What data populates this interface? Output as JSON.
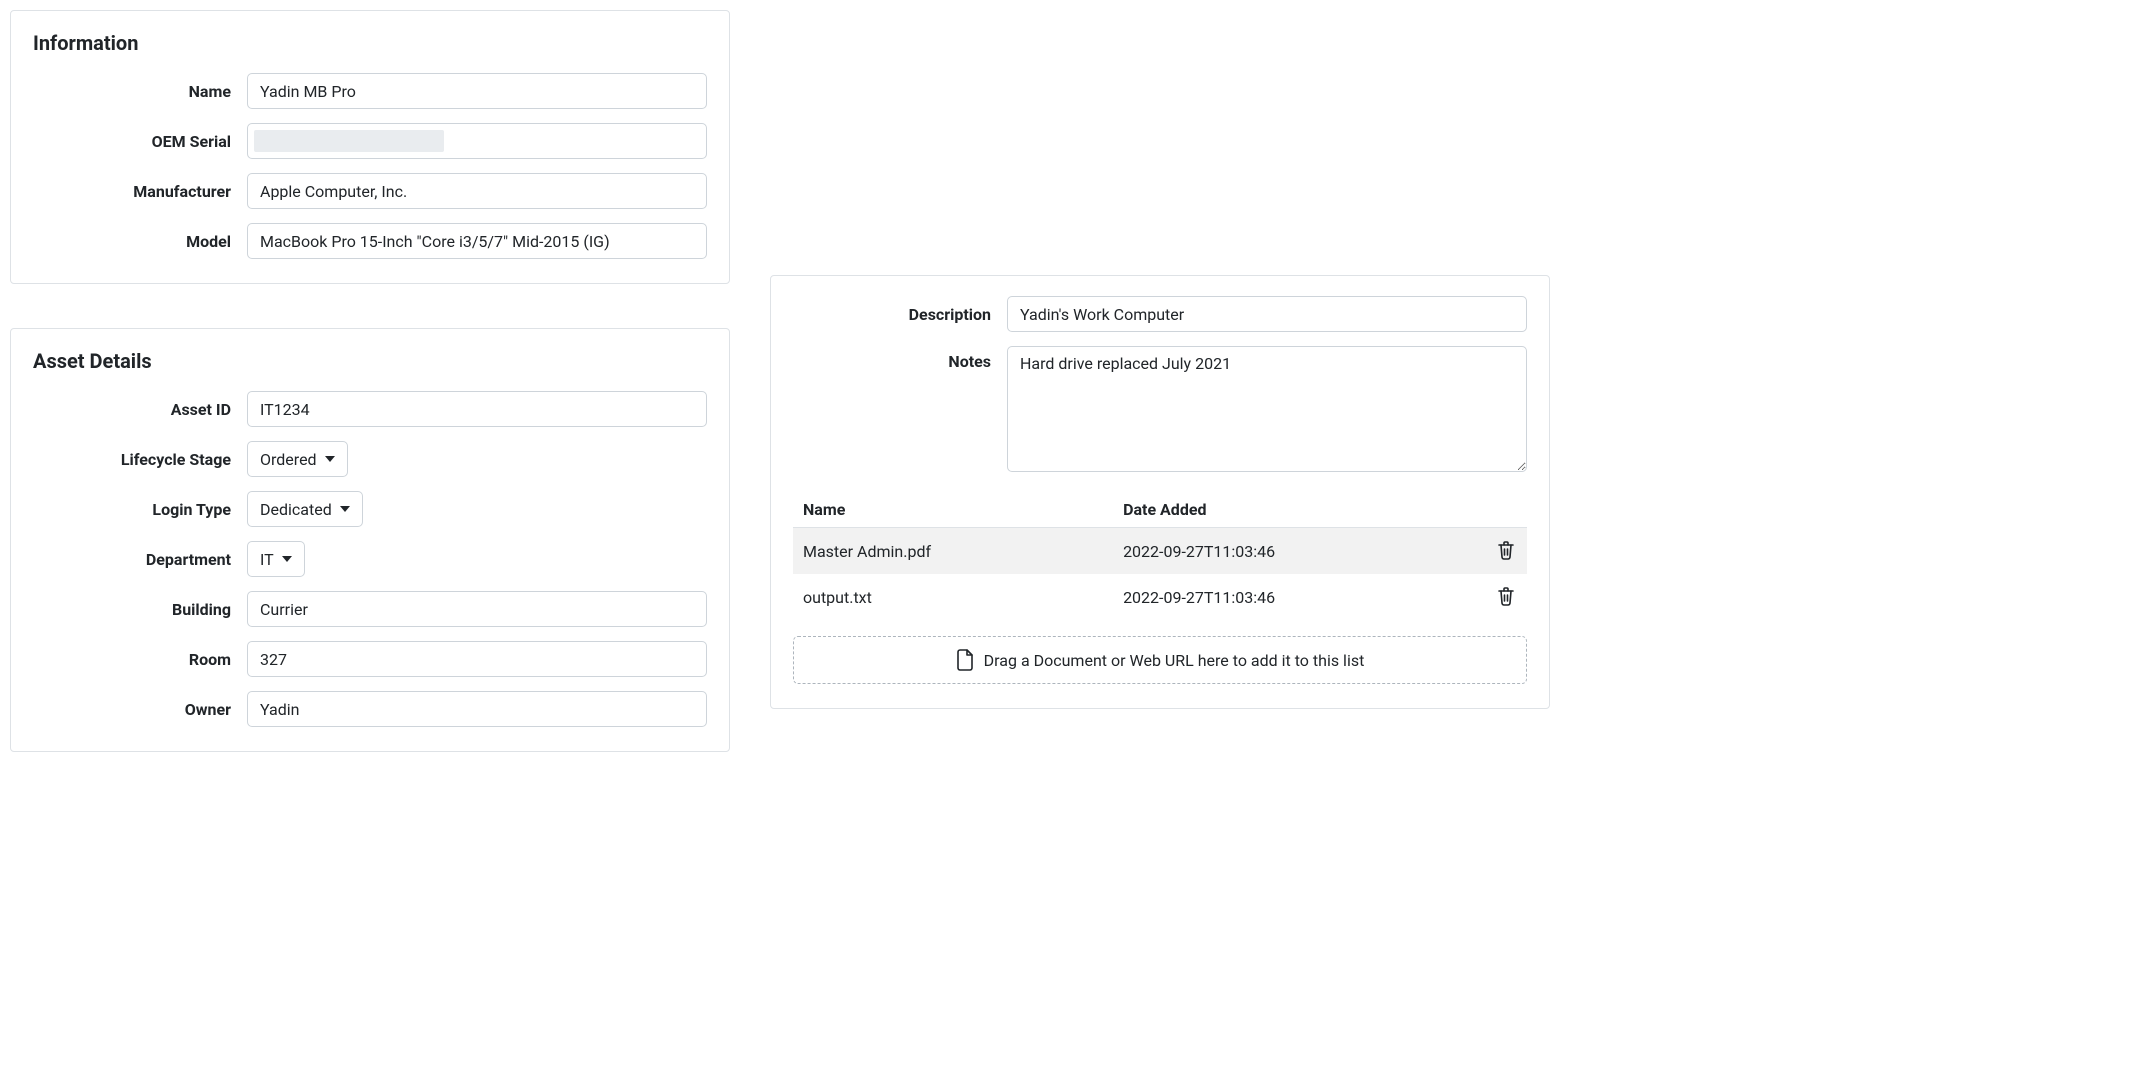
{
  "information": {
    "title": "Information",
    "labels": {
      "name": "Name",
      "oem_serial": "OEM Serial",
      "manufacturer": "Manufacturer",
      "model": "Model"
    },
    "values": {
      "name": "Yadin MB Pro",
      "oem_serial": "",
      "manufacturer": "Apple Computer, Inc.",
      "model": "MacBook Pro 15-Inch \"Core i3/5/7\" Mid-2015 (IG)"
    }
  },
  "asset_details": {
    "title": "Asset Details",
    "labels": {
      "asset_id": "Asset ID",
      "lifecycle_stage": "Lifecycle Stage",
      "login_type": "Login Type",
      "department": "Department",
      "building": "Building",
      "room": "Room",
      "owner": "Owner"
    },
    "values": {
      "asset_id": "IT1234",
      "lifecycle_stage": "Ordered",
      "login_type": "Dedicated",
      "department": "IT",
      "building": "Currier",
      "room": "327",
      "owner": "Yadin"
    }
  },
  "desc": {
    "labels": {
      "description": "Description",
      "notes": "Notes"
    },
    "values": {
      "description": "Yadin's Work Computer",
      "notes": "Hard drive replaced July 2021"
    }
  },
  "documents": {
    "columns": {
      "name": "Name",
      "date_added": "Date Added"
    },
    "rows": [
      {
        "name": "Master Admin.pdf",
        "date_added": "2022-09-27T11:03:46"
      },
      {
        "name": "output.txt",
        "date_added": "2022-09-27T11:03:46"
      }
    ],
    "dropzone_text": "Drag a Document or Web URL here to add it to this list"
  }
}
